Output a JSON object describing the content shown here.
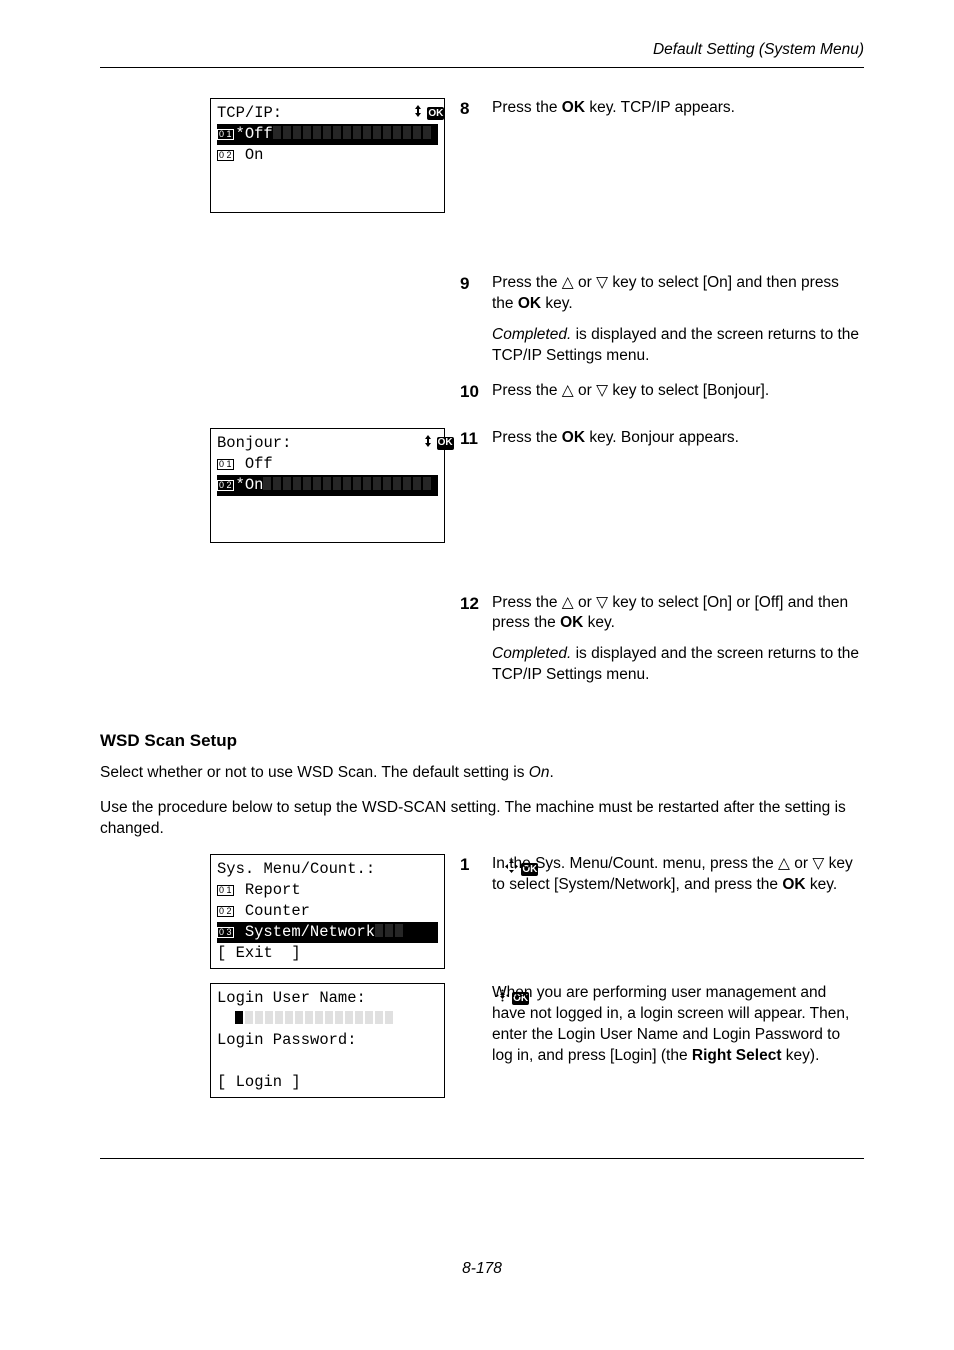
{
  "running_head": "Default Setting (System Menu)",
  "lcd1": {
    "title": "TCP/IP:",
    "opt1_num": "0 1",
    "opt1_txt": "*Off",
    "opt2_num": "0 2",
    "opt2_txt": " On"
  },
  "lcd2": {
    "title": "Bonjour:",
    "opt1_num": "0 1",
    "opt1_txt": " Off",
    "opt2_num": "0 2",
    "opt2_txt": "*On"
  },
  "lcd3": {
    "title": "Sys. Menu/Count.:",
    "row1_num": "0 1",
    "row1_txt": " Report",
    "row2_num": "0 2",
    "row2_txt": " Counter",
    "row3_num": "0 3",
    "row3_txt": " System/Network",
    "foot": "[ Exit  ]"
  },
  "lcd4": {
    "title": "Login User Name:",
    "row2": "Login Password:",
    "foot": "[ Login ]"
  },
  "steps": {
    "s8_num": "8",
    "s8_txt": "Press the OK key. TCP/IP appears.",
    "s9_num": "9",
    "s9_a": "Press the △ or ▽ key to select [On] and then press the OK key.",
    "s9_b": "Completed. is displayed and the screen returns to the TCP/IP Settings menu.",
    "s10_num": "10",
    "s10_txt": "Press the △ or ▽ key to select [Bonjour].",
    "s11_num": "11",
    "s11_txt": "Press the OK key. Bonjour appears.",
    "s12_num": "12",
    "s12_a": "Press the △ or ▽ key to select [On] or [Off] and then press the OK key.",
    "s12_b": "Completed. is displayed and the screen returns to the TCP/IP Settings menu.",
    "wsd_s1_num": "1",
    "wsd_s1_txt": "In the Sys. Menu/Count. menu, press the △ or ▽ key to select [System/Network], and press the OK key.",
    "wsd_lcd4_txt": "When you are performing user management and have not logged in, a login screen will appear. Then, enter the Login User Name and Login Password to log in, and press [Login] (the Right Select key)."
  },
  "section": {
    "title": "WSD Scan Setup",
    "p1_a": "Select whether or not to use WSD Scan. The default setting is ",
    "p1_b": "On",
    "p1_c": ".",
    "p2": "Use the procedure below to setup the WSD-SCAN setting. The machine must be restarted after the setting is changed."
  },
  "footer": "8-178",
  "ok_label": "OK"
}
